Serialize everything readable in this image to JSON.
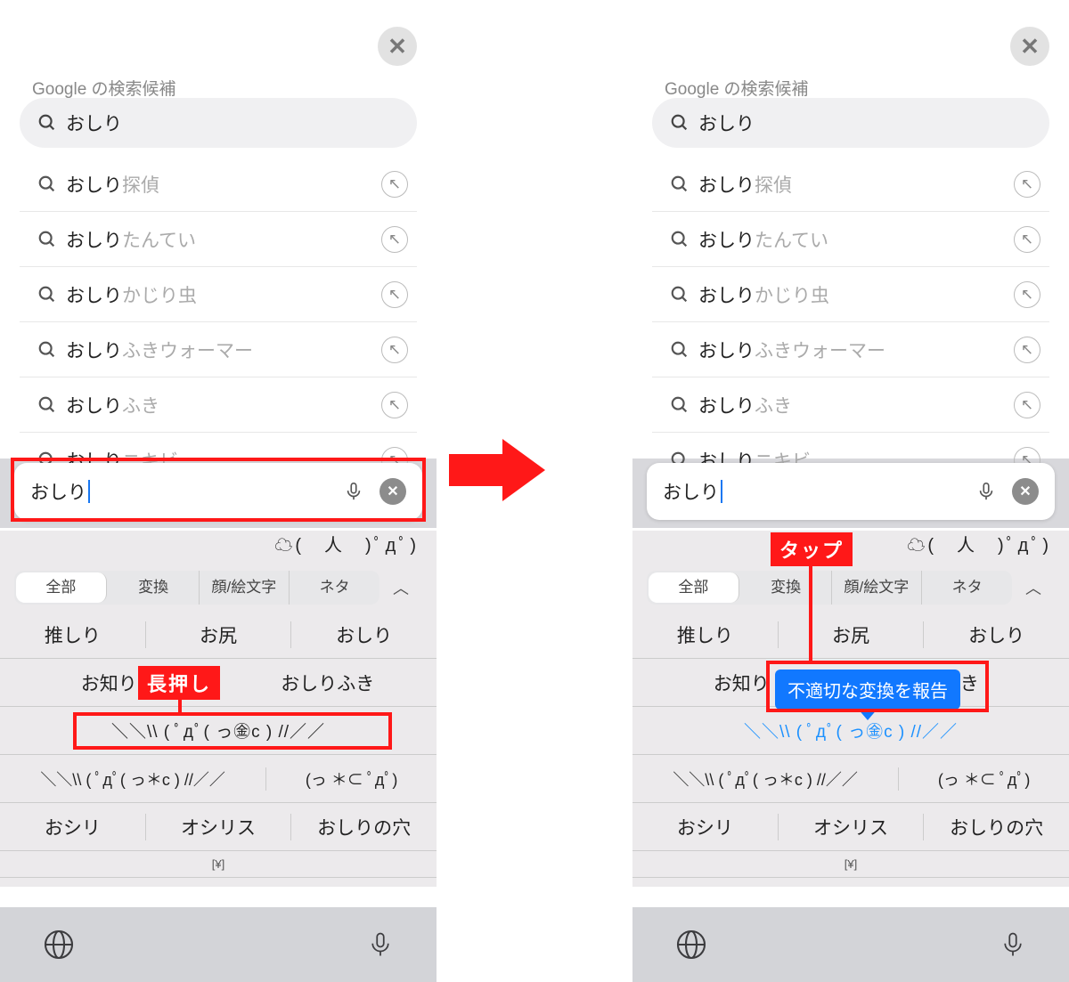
{
  "left": {
    "sugg_header": "Google の検索候補",
    "query": "おしり",
    "suggestions": [
      {
        "bold": "おしり",
        "gray": "探偵"
      },
      {
        "bold": "おしり",
        "gray": "たんてい"
      },
      {
        "bold": "おしり",
        "gray": "かじり虫"
      },
      {
        "bold": "おしり",
        "gray": "ふきウォーマー"
      },
      {
        "bold": "おしり",
        "gray": "ふき"
      },
      {
        "bold": "おしり",
        "gray": "ニキビ"
      }
    ],
    "input_text": "おしり",
    "kaomoji_row": "☁(　人　)ﾟдﾟ)",
    "tabs": {
      "active": "全部",
      "items": [
        "全部",
        "変換",
        "顔/絵文字",
        "ネタ"
      ]
    },
    "grid": [
      [
        "推しり",
        "お尻",
        "おしり"
      ],
      [
        "お知り",
        "",
        "おしりふき"
      ],
      [
        "＼＼\\\\ ( ﾟдﾟ( っ㊎c ) //／／"
      ],
      [
        "＼＼\\\\ ( ﾟдﾟ( っ＊c ) //／／",
        "(っ ＊⊂ ﾟдﾟ)"
      ],
      [
        "おシリ",
        "オシリス",
        "おしりの穴"
      ]
    ],
    "yen": "[¥]",
    "label": "長押し"
  },
  "right": {
    "sugg_header": "Google の検索候補",
    "query": "おしり",
    "suggestions": [
      {
        "bold": "おしり",
        "gray": "探偵"
      },
      {
        "bold": "おしり",
        "gray": "たんてい"
      },
      {
        "bold": "おしり",
        "gray": "かじり虫"
      },
      {
        "bold": "おしり",
        "gray": "ふきウォーマー"
      },
      {
        "bold": "おしり",
        "gray": "ふき"
      },
      {
        "bold": "おしり",
        "gray": "ニキビ"
      }
    ],
    "input_text": "おしり",
    "kaomoji_row": "☁(　人　)ﾟдﾟ)",
    "tabs": {
      "active": "全部",
      "items": [
        "全部",
        "変換",
        "顔/絵文字",
        "ネタ"
      ]
    },
    "grid": [
      [
        "推しり",
        "お尻",
        "おしり"
      ],
      [
        "お知り",
        "",
        "ふき"
      ],
      [
        "＼＼\\\\ ( ﾟдﾟ( っ㊎c ) //／／"
      ],
      [
        "＼＼\\\\ ( ﾟдﾟ( っ＊c ) //／／",
        "(っ ＊⊂ ﾟдﾟ)"
      ],
      [
        "おシリ",
        "オシリス",
        "おしりの穴"
      ]
    ],
    "yen": "[¥]",
    "label": "タップ",
    "tooltip": "不適切な変換を報告"
  }
}
